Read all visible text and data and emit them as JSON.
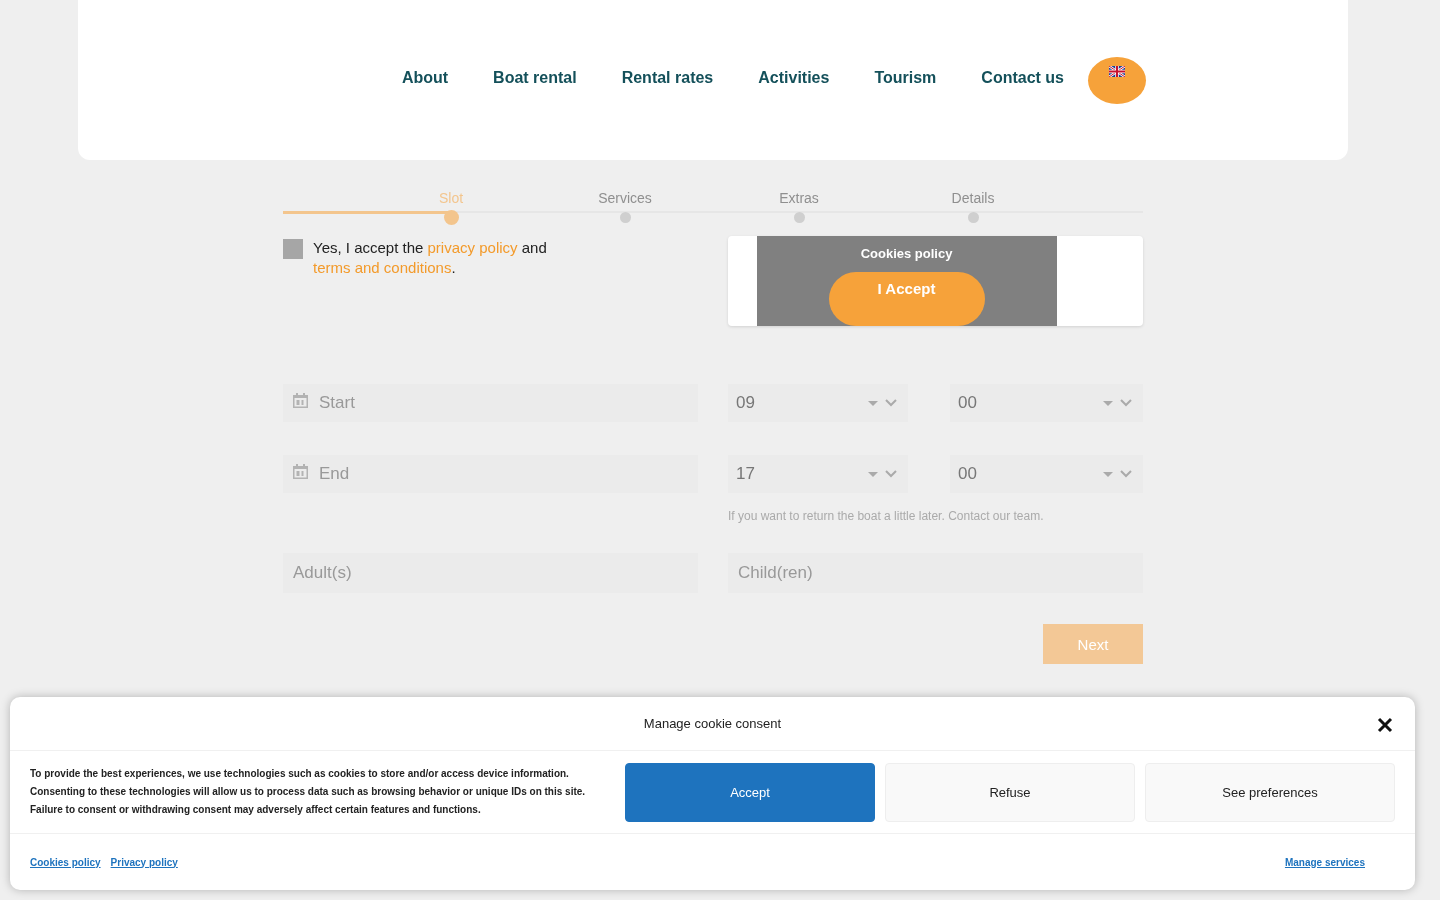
{
  "nav": {
    "items": [
      {
        "label": "About"
      },
      {
        "label": "Boat rental"
      },
      {
        "label": "Rental rates"
      },
      {
        "label": "Activities"
      },
      {
        "label": "Tourism"
      },
      {
        "label": "Contact us"
      }
    ]
  },
  "steps": [
    {
      "label": "Slot",
      "selected": true
    },
    {
      "label": "Services",
      "selected": false
    },
    {
      "label": "Extras",
      "selected": false
    },
    {
      "label": "Details",
      "selected": false
    }
  ],
  "consent": {
    "checked": false,
    "segments": [
      {
        "kind": "text",
        "text": "Yes, I accept the "
      },
      {
        "kind": "link",
        "text": "privacy policy"
      },
      {
        "kind": "text",
        "text": " and "
      },
      {
        "kind": "link",
        "text": "terms and conditions"
      },
      {
        "kind": "text",
        "text": "."
      }
    ]
  },
  "cookie_widget": {
    "title": "Cookies policy",
    "button": "I Accept"
  },
  "rows": [
    {
      "date_placeholder": "Start",
      "hour": "09",
      "minute": "00"
    },
    {
      "date_placeholder": "End",
      "hour": "17",
      "minute": "00",
      "hint": "If you want to return the boat a little later. Contact our team."
    }
  ],
  "guests": [
    {
      "placeholder": "Adult(s)"
    },
    {
      "placeholder": "Child(ren)"
    }
  ],
  "next_button": {
    "label": "Next",
    "disabled": true
  },
  "cookie_banner": {
    "title": "Manage cookie consent",
    "text": "To provide the best experiences, we use technologies such as cookies to store and/or access device information. Consenting to these technologies will allow us to process data such as browsing behavior or unique IDs on this site. Failure to consent or withdrawing consent may adversely affect certain features and functions.",
    "buttons": [
      {
        "label": "Accept",
        "kind": "primary"
      },
      {
        "label": "Refuse",
        "kind": "secondary"
      },
      {
        "label": "See preferences",
        "kind": "secondary"
      }
    ],
    "links": [
      {
        "label": "Cookies policy"
      },
      {
        "label": "Privacy policy"
      }
    ],
    "manage_link": "Manage services"
  }
}
